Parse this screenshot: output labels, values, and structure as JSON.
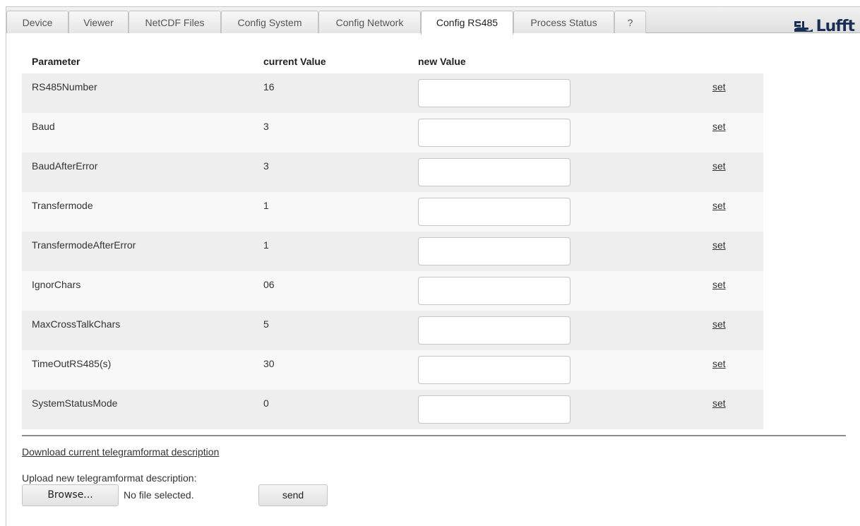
{
  "tabs": [
    {
      "label": "Device",
      "active": false
    },
    {
      "label": "Viewer",
      "active": false
    },
    {
      "label": "NetCDF Files",
      "active": false
    },
    {
      "label": "Config System",
      "active": false
    },
    {
      "label": "Config Network",
      "active": false
    },
    {
      "label": "Config RS485",
      "active": true
    },
    {
      "label": "Process Status",
      "active": false
    },
    {
      "label": "?",
      "active": false
    }
  ],
  "logo": {
    "text": "Lufft",
    "icon": "lufft-logo-icon",
    "color": "#1a2e55"
  },
  "table": {
    "headers": {
      "parameter": "Parameter",
      "current": "current Value",
      "new": "new Value"
    },
    "set_label": "set",
    "rows": [
      {
        "parameter": "RS485Number",
        "current": "16",
        "new_value": ""
      },
      {
        "parameter": "Baud",
        "current": "3",
        "new_value": ""
      },
      {
        "parameter": "BaudAfterError",
        "current": "3",
        "new_value": ""
      },
      {
        "parameter": "Transfermode",
        "current": "1",
        "new_value": ""
      },
      {
        "parameter": "TransfermodeAfterError",
        "current": "1",
        "new_value": ""
      },
      {
        "parameter": "IgnorChars",
        "current": "06",
        "new_value": ""
      },
      {
        "parameter": "MaxCrossTalkChars",
        "current": "5",
        "new_value": ""
      },
      {
        "parameter": "TimeOutRS485(s)",
        "current": "30",
        "new_value": ""
      },
      {
        "parameter": "SystemStatusMode",
        "current": "0",
        "new_value": ""
      }
    ]
  },
  "download": {
    "link_label": "Download current telegramformat description"
  },
  "upload": {
    "label": "Upload new telegramformat description:",
    "browse_label": "Browse...",
    "file_status": "No file selected.",
    "send_label": "send"
  }
}
